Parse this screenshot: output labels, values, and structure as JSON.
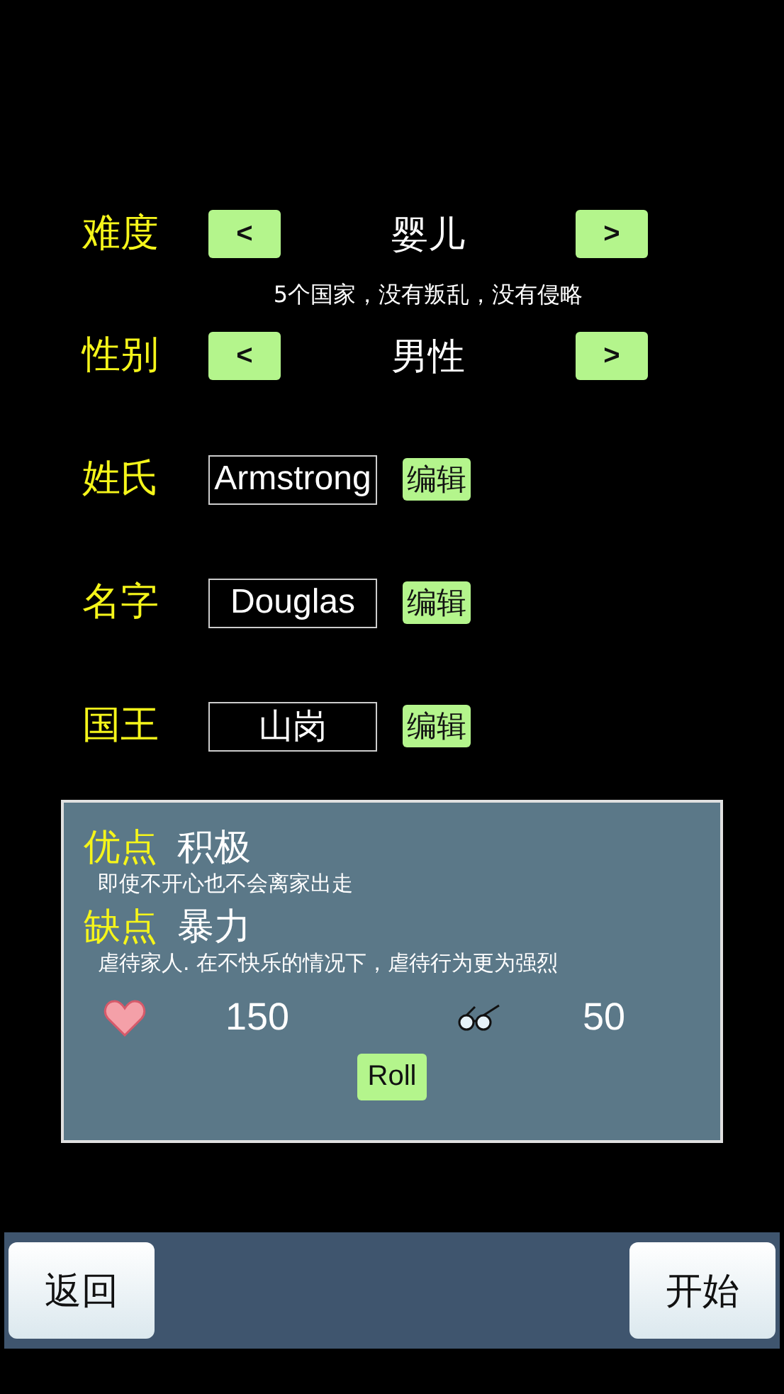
{
  "selectors": [
    {
      "label": "难度",
      "prev": "<",
      "value": "婴儿",
      "next": ">",
      "description": "5个国家，没有叛乱，没有侵略"
    },
    {
      "label": "性别",
      "prev": "<",
      "value": "男性",
      "next": ">"
    }
  ],
  "name_fields": [
    {
      "label": "姓氏",
      "value": "Armstrong",
      "edit": "编辑"
    },
    {
      "label": "名字",
      "value": "Douglas",
      "edit": "编辑"
    },
    {
      "label": "国王",
      "value": "山岗",
      "edit": "编辑"
    }
  ],
  "traits": [
    {
      "label": "优点",
      "value": "积极",
      "description": "即使不开心也不会离家出走"
    },
    {
      "label": "缺点",
      "value": "暴力",
      "description": "虐待家人. 在不快乐的情况下，虐待行为更为强烈"
    }
  ],
  "stats": [
    {
      "kind": "heart",
      "value": "150"
    },
    {
      "kind": "glasses",
      "value": "50"
    }
  ],
  "roll_button": "Roll",
  "footer": {
    "back": "返回",
    "start": "开始"
  }
}
